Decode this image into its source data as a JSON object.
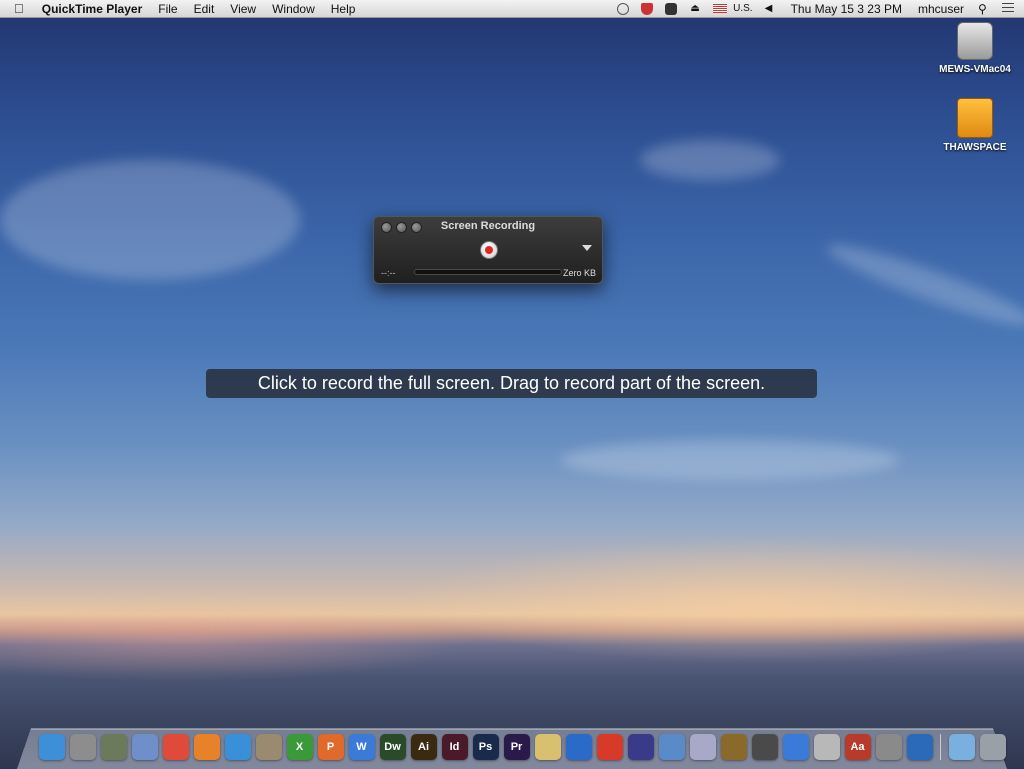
{
  "menubar": {
    "app_name": "QuickTime Player",
    "menus": [
      "File",
      "Edit",
      "View",
      "Window",
      "Help"
    ],
    "input_source": "U.S.",
    "datetime": "Thu May 15  3 23 PM",
    "user": "mhcuser"
  },
  "desktop_icons": [
    {
      "label": "MEWS-VMac04",
      "icon": "hard-drive-icon"
    },
    {
      "label": "THAWSPACE",
      "icon": "external-drive-icon"
    }
  ],
  "recording_window": {
    "title": "Screen Recording",
    "elapsed": "--:--",
    "file_size": "Zero KB",
    "record_color": "#e0281e"
  },
  "hint": "Click to record the full screen. Drag to record part of the screen.",
  "dock": {
    "apps": [
      {
        "icon": "finder-icon",
        "text": "",
        "color": "#3d8fd8"
      },
      {
        "icon": "launchpad-icon",
        "text": "",
        "color": "#8d8d8d"
      },
      {
        "icon": "mission-control-icon",
        "text": "",
        "color": "#6a7a5a"
      },
      {
        "icon": "textedit-icon",
        "text": "",
        "color": "#6e8fc9"
      },
      {
        "icon": "chrome-icon",
        "text": "",
        "color": "#e04a3a"
      },
      {
        "icon": "firefox-icon",
        "text": "",
        "color": "#e8822a"
      },
      {
        "icon": "safari-icon",
        "text": "",
        "color": "#3a90d8"
      },
      {
        "icon": "gimp-icon",
        "text": "",
        "color": "#9a8a70"
      },
      {
        "icon": "excel-icon",
        "text": "X",
        "color": "#3a9a3a"
      },
      {
        "icon": "powerpoint-icon",
        "text": "P",
        "color": "#e06a2a"
      },
      {
        "icon": "word-icon",
        "text": "W",
        "color": "#3a7ad8"
      },
      {
        "icon": "dreamweaver-icon",
        "text": "Dw",
        "color": "#2a4a2a"
      },
      {
        "icon": "illustrator-icon",
        "text": "Ai",
        "color": "#3a2a10"
      },
      {
        "icon": "indesign-icon",
        "text": "Id",
        "color": "#4a1a2a"
      },
      {
        "icon": "photoshop-icon",
        "text": "Ps",
        "color": "#1a2a4a"
      },
      {
        "icon": "premiere-icon",
        "text": "Pr",
        "color": "#2a1a4a"
      },
      {
        "icon": "stickies-icon",
        "text": "",
        "color": "#d8c070"
      },
      {
        "icon": "google-earth-icon",
        "text": "",
        "color": "#2a6ac8"
      },
      {
        "icon": "sketchup-icon",
        "text": "",
        "color": "#d83a2a"
      },
      {
        "icon": "audio-app-icon",
        "text": "",
        "color": "#3a3a8a"
      },
      {
        "icon": "dvd-player-icon",
        "text": "",
        "color": "#5a8ac8"
      },
      {
        "icon": "disc-burner-icon",
        "text": "",
        "color": "#a8a8c8"
      },
      {
        "icon": "imovie-icon",
        "text": "",
        "color": "#8a6a2a"
      },
      {
        "icon": "final-cut-icon",
        "text": "",
        "color": "#4a4a4a"
      },
      {
        "icon": "itunes-icon",
        "text": "",
        "color": "#3a7ad8"
      },
      {
        "icon": "calculator-icon",
        "text": "",
        "color": "#b8b8b8"
      },
      {
        "icon": "dictionary-icon",
        "text": "Aa",
        "color": "#b83a2a"
      },
      {
        "icon": "preview-icon",
        "text": "",
        "color": "#8a8a8a"
      },
      {
        "icon": "quicktime-icon",
        "text": "",
        "color": "#2a6ab8"
      }
    ],
    "stacks": [
      {
        "icon": "downloads-folder-icon",
        "color": "#7ab0e0"
      },
      {
        "icon": "trash-icon",
        "color": "#9aa0a8"
      }
    ]
  }
}
